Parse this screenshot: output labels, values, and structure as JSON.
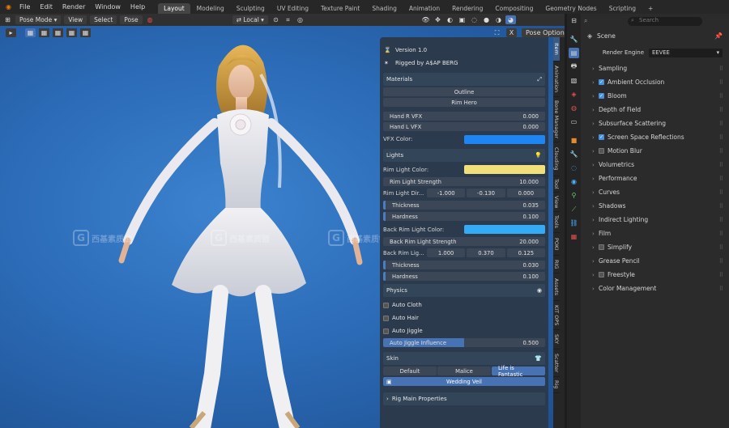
{
  "menu": {
    "file": "File",
    "edit": "Edit",
    "render": "Render",
    "window": "Window",
    "help": "Help"
  },
  "workspaces": [
    "Layout",
    "Modeling",
    "Sculpting",
    "UV Editing",
    "Texture Paint",
    "Shading",
    "Animation",
    "Rendering",
    "Compositing",
    "Geometry Nodes",
    "Scripting"
  ],
  "viewport_header": {
    "mode": "Pose Mode",
    "view": "View",
    "select": "Select",
    "pose": "Pose",
    "transform": "Local",
    "pose_options": "Pose Options"
  },
  "watermark": "西基素质链",
  "npanel": {
    "version": "Version 1.0",
    "rigged_by": "Rigged by A$AP BERG",
    "materials": {
      "title": "Materials",
      "outline": "Outline",
      "rim_hero": "Rim Hero",
      "hand_r_vfx": {
        "label": "Hand R VFX",
        "value": "0.000"
      },
      "hand_l_vfx": {
        "label": "Hand L VFX",
        "value": "0.000"
      },
      "vfx_color_label": "VFX Color:",
      "vfx_color": "#1d86f2"
    },
    "lights": {
      "title": "Lights",
      "rim_light_color_label": "Rim Light Color:",
      "rim_light_color": "#f1e07a",
      "rim_light_strength": {
        "label": "Rim Light Strength",
        "value": "10.000"
      },
      "rim_light_dir": {
        "label": "Rim Light Dir...",
        "x": "-1.000",
        "y": "-0.130",
        "z": "0.000"
      },
      "thickness1": {
        "label": "Thickness",
        "value": "0.035"
      },
      "hardness1": {
        "label": "Hardness",
        "value": "0.100"
      },
      "back_rim_light_color_label": "Back Rim Light Color:",
      "back_rim_light_color": "#35aaf5",
      "back_rim_light_strength": {
        "label": "Back Rim Light Strength",
        "value": "20.000"
      },
      "back_rim_lig": {
        "label": "Back Rim Lig...",
        "x": "1.000",
        "y": "0.370",
        "z": "0.125"
      },
      "thickness2": {
        "label": "Thickness",
        "value": "0.030"
      },
      "hardness2": {
        "label": "Hardness",
        "value": "0.100"
      }
    },
    "physics": {
      "title": "Physics",
      "auto_cloth": "Auto Cloth",
      "auto_hair": "Auto Hair",
      "auto_jiggle": "Auto Jiggle",
      "jiggle_influence": {
        "label": "Auto Jiggle Influence",
        "value": "0.500",
        "fraction": 0.5
      }
    },
    "skin": {
      "title": "Skin",
      "options": [
        "Default",
        "Malice",
        "Life is Fantastic"
      ],
      "selected": "Life is Fantastic",
      "wedding_veil": "Wedding Veil"
    },
    "rig_main_properties": "Rig Main Properties"
  },
  "vertical_tabs": [
    "Item",
    "Animation",
    "Bone Manager",
    "Clouding",
    "Tool",
    "View",
    "Tools",
    "POKI",
    "RIG",
    "Assets",
    "KIT OPS",
    "SKY",
    "Scatter",
    "Rig"
  ],
  "properties": {
    "search_placeholder": "Search",
    "scene": "Scene",
    "render_engine_label": "Render Engine",
    "render_engine": "EEVEE",
    "items": [
      {
        "label": "Sampling",
        "checkbox": null
      },
      {
        "label": "Ambient Occlusion",
        "checkbox": true
      },
      {
        "label": "Bloom",
        "checkbox": true
      },
      {
        "label": "Depth of Field",
        "checkbox": null
      },
      {
        "label": "Subsurface Scattering",
        "checkbox": null
      },
      {
        "label": "Screen Space Reflections",
        "checkbox": true
      },
      {
        "label": "Motion Blur",
        "checkbox": false
      },
      {
        "label": "Volumetrics",
        "checkbox": null
      },
      {
        "label": "Performance",
        "checkbox": null
      },
      {
        "label": "Curves",
        "checkbox": null
      },
      {
        "label": "Shadows",
        "checkbox": null
      },
      {
        "label": "Indirect Lighting",
        "checkbox": null
      },
      {
        "label": "Film",
        "checkbox": null
      },
      {
        "label": "Simplify",
        "checkbox": false
      },
      {
        "label": "Grease Pencil",
        "checkbox": null
      },
      {
        "label": "Freestyle",
        "checkbox": false
      },
      {
        "label": "Color Management",
        "checkbox": null
      }
    ]
  }
}
